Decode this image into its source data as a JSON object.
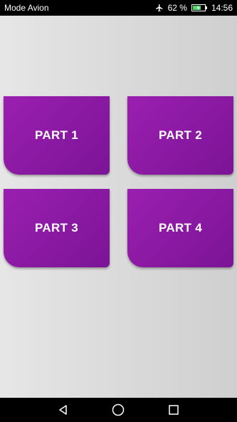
{
  "status_bar": {
    "carrier": "Mode Avion",
    "battery_percent": "62 %",
    "time": "14:56"
  },
  "parts": [
    {
      "label": "PART 1"
    },
    {
      "label": "PART 2"
    },
    {
      "label": "PART 3"
    },
    {
      "label": "PART 4"
    }
  ],
  "colors": {
    "card_start": "#9b1fb0",
    "card_end": "#7b1496",
    "background": "#dcdcdc"
  },
  "icons": {
    "airplane": "airplane-icon",
    "battery": "battery-charging-icon",
    "back": "back-icon",
    "home": "home-icon",
    "recents": "recents-icon"
  }
}
